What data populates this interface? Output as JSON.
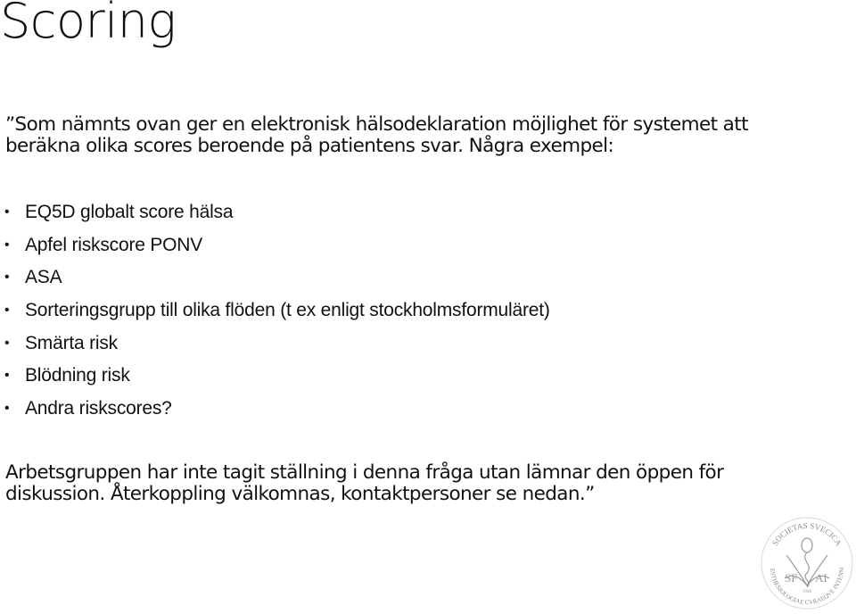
{
  "slide": {
    "title": "Scoring",
    "intro_line1": "”Som nämnts ovan ger en elektronisk hälsodeklaration möjlighet för systemet att",
    "intro_line2": "beräkna olika scores beroende på patientens svar. Några exempel:",
    "bullets": [
      "EQ5D globalt score hälsa",
      "Apfel riskscore PONV",
      "ASA",
      "Sorteringsgrupp till olika flöden (t ex enligt stockholmsformuläret)",
      "Smärta risk",
      "Blödning risk",
      "Andra riskscores?"
    ],
    "bullet_glyph": "•",
    "closing_line1": "Arbetsgruppen har inte tagit ställning i denna fråga utan lämnar den öppen för",
    "closing_line2": "diskussion. Återkoppling välkomnas, kontaktpersoner se nedan.”"
  },
  "logo": {
    "icon": "society-seal-icon",
    "top_text": "SOCIETAS SVECICA",
    "side_text": "ANAESTHESIOLOGIAE CVRAEQVE INTENSIVAE",
    "left_letters": "SF",
    "right_letters": "AI",
    "year": "1946",
    "color": "#8a8a8a"
  }
}
